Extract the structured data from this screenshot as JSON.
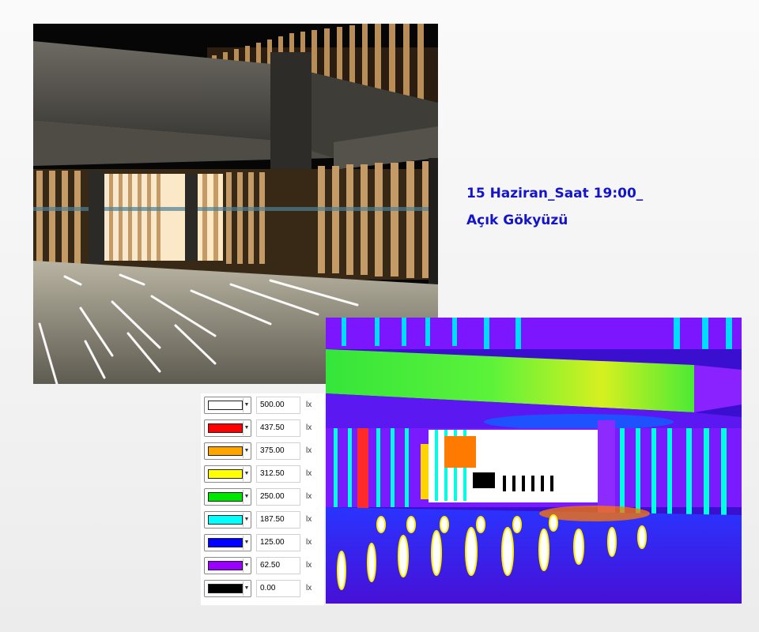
{
  "caption": {
    "line1": "15 Haziran_Saat 19:00_",
    "line2": "Açık Gökyüzü"
  },
  "legend": {
    "unit": "lx",
    "entries": [
      {
        "value": "500.00",
        "color": "#ffffff"
      },
      {
        "value": "437.50",
        "color": "#ff0000"
      },
      {
        "value": "375.00",
        "color": "#ffa500"
      },
      {
        "value": "312.50",
        "color": "#ffff00"
      },
      {
        "value": "250.00",
        "color": "#00e600"
      },
      {
        "value": "187.50",
        "color": "#00ffff"
      },
      {
        "value": "125.00",
        "color": "#0000ff"
      },
      {
        "value": "62.50",
        "color": "#9900ff"
      },
      {
        "value": "0.00",
        "color": "#000000"
      }
    ]
  },
  "icons": {
    "dropdown": "chevron-down-icon"
  }
}
